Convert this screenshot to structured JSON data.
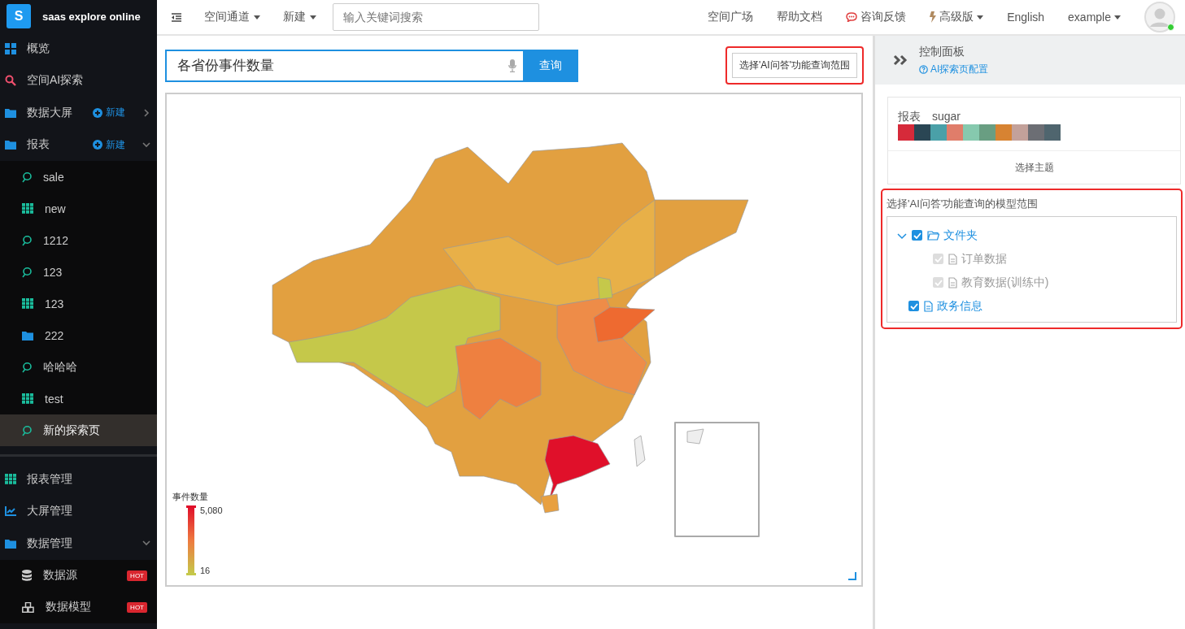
{
  "sidebar": {
    "logo_letter": "S",
    "app_name": "saas explore online",
    "groups": [
      [
        {
          "label": "概览",
          "kind": "windows"
        },
        {
          "label": "空间AI探索",
          "kind": "search"
        },
        {
          "label": "数据大屏",
          "kind": "folder",
          "action": "新建",
          "expanded": false
        },
        {
          "label": "报表",
          "kind": "folder",
          "action": "新建",
          "expanded": true,
          "children": [
            {
              "label": "sale",
              "kind": "loop",
              "selected": false
            },
            {
              "label": "new",
              "kind": "grid",
              "selected": false
            },
            {
              "label": "1212",
              "kind": "loop",
              "selected": false
            },
            {
              "label": "123",
              "kind": "loop",
              "selected": false
            },
            {
              "label": "123",
              "kind": "grid",
              "selected": false
            },
            {
              "label": "222",
              "kind": "folder",
              "selected": false
            },
            {
              "label": "哈哈哈",
              "kind": "loop",
              "selected": false
            },
            {
              "label": "test",
              "kind": "grid",
              "selected": false
            },
            {
              "label": "新的探索页",
              "kind": "loop",
              "selected": true
            }
          ]
        }
      ],
      [
        {
          "label": "报表管理",
          "kind": "grid"
        },
        {
          "label": "大屏管理",
          "kind": "chart"
        },
        {
          "label": "数据管理",
          "kind": "folder",
          "expanded": true,
          "children": [
            {
              "label": "数据源",
              "kind": "database",
              "badge": "HOT",
              "selected": false
            },
            {
              "label": "数据模型",
              "kind": "cubes",
              "badge": "HOT",
              "selected": false
            }
          ]
        }
      ]
    ]
  },
  "topbar": {
    "nav": [
      {
        "label": "空间通道",
        "dropdown": true
      },
      {
        "label": "新建",
        "dropdown": true
      }
    ],
    "search": {
      "placeholder": "输入关键词搜索"
    },
    "links": [
      {
        "label": "空间广场",
        "kind": "plain",
        "dropdown": false
      },
      {
        "label": "帮助文档",
        "kind": "plain",
        "dropdown": false
      },
      {
        "label": "咨询反馈",
        "kind": "chat",
        "dropdown": false
      },
      {
        "label": "高级版",
        "kind": "bolt",
        "dropdown": true
      },
      {
        "label": "English",
        "kind": "plain",
        "dropdown": false
      },
      {
        "label": "example",
        "kind": "plain",
        "dropdown": true
      }
    ],
    "user": {
      "online": true
    }
  },
  "query": {
    "value": "各省份事件数量",
    "button": "查询",
    "scope_button": "选择'AI问答'功能查询范围",
    "scope_highlighted": true
  },
  "map": {
    "legend": {
      "title": "事件数量",
      "max": "5,080",
      "min": "16"
    }
  },
  "control_panel": {
    "title": "控制面板",
    "link": "AI探索页配置",
    "theme": {
      "label": "报表",
      "name": "sugar",
      "button": "选择主题",
      "swatches": [
        {
          "color": "#d62a3a"
        },
        {
          "color": "#2a4654"
        },
        {
          "color": "#4aa0a8"
        },
        {
          "color": "#e07d6a"
        },
        {
          "color": "#86c9ae"
        },
        {
          "color": "#699e82"
        },
        {
          "color": "#d78332"
        },
        {
          "color": "#c3a19a"
        },
        {
          "color": "#6c6e74"
        },
        {
          "color": "#4f656e"
        }
      ]
    },
    "scope": {
      "label": "选择'AI问答'功能查询的模型范围",
      "highlighted": true,
      "tree": [
        {
          "label": "文件夹",
          "kind": "folder",
          "checked": true,
          "disabled": false,
          "expanded": true,
          "children": [
            {
              "label": "订单数据",
              "kind": "file",
              "checked": true,
              "disabled": true
            },
            {
              "label": "教育数据(训练中)",
              "kind": "file",
              "checked": true,
              "disabled": true
            }
          ]
        },
        {
          "label": "政务信息",
          "kind": "file",
          "checked": true,
          "disabled": false
        }
      ]
    }
  }
}
